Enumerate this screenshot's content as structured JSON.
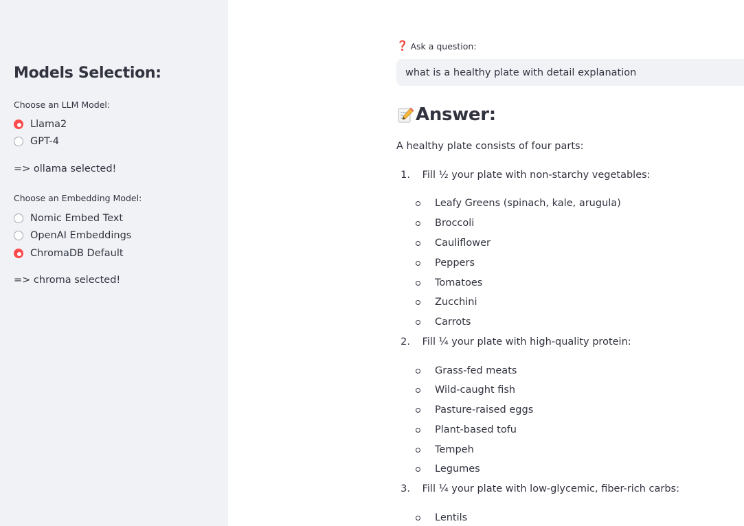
{
  "sidebar": {
    "title": "Models Selection:",
    "llm_label": "Choose an LLM Model:",
    "llm_options": [
      {
        "label": "Llama2",
        "selected": true
      },
      {
        "label": "GPT-4",
        "selected": false
      }
    ],
    "llm_status": "=> ollama selected!",
    "embed_label": "Choose an Embedding Model:",
    "embed_options": [
      {
        "label": "Nomic Embed Text",
        "selected": false
      },
      {
        "label": "OpenAI Embeddings",
        "selected": false
      },
      {
        "label": "ChromaDB Default",
        "selected": true
      }
    ],
    "embed_status": "=> chroma selected!"
  },
  "main": {
    "question_icon": "❓",
    "question_label": "Ask a question:",
    "question_value": "what is a healthy plate with detail explanation",
    "answer_heading": "Answer:",
    "answer_icon": "pencil-memo-icon",
    "intro": "A healthy plate consists of four parts:",
    "sections": [
      {
        "number": "1.",
        "text": "Fill ½ your plate with non-starchy vegetables:",
        "items": [
          "Leafy Greens (spinach, kale, arugula)",
          "Broccoli",
          "Cauliflower",
          "Peppers",
          "Tomatoes",
          "Zucchini",
          "Carrots"
        ]
      },
      {
        "number": "2.",
        "text": "Fill ¼ your plate with high-quality protein:",
        "items": [
          "Grass-fed meats",
          "Wild-caught fish",
          "Pasture-raised eggs",
          "Plant-based tofu",
          "Tempeh",
          "Legumes"
        ]
      },
      {
        "number": "3.",
        "text": "Fill ¼ your plate with low-glycemic, fiber-rich carbs:",
        "items": [
          "Lentils"
        ]
      }
    ]
  },
  "colors": {
    "accent": "#ff4b4b",
    "sidebar_bg": "#f0f2f6",
    "text": "#31333f"
  }
}
